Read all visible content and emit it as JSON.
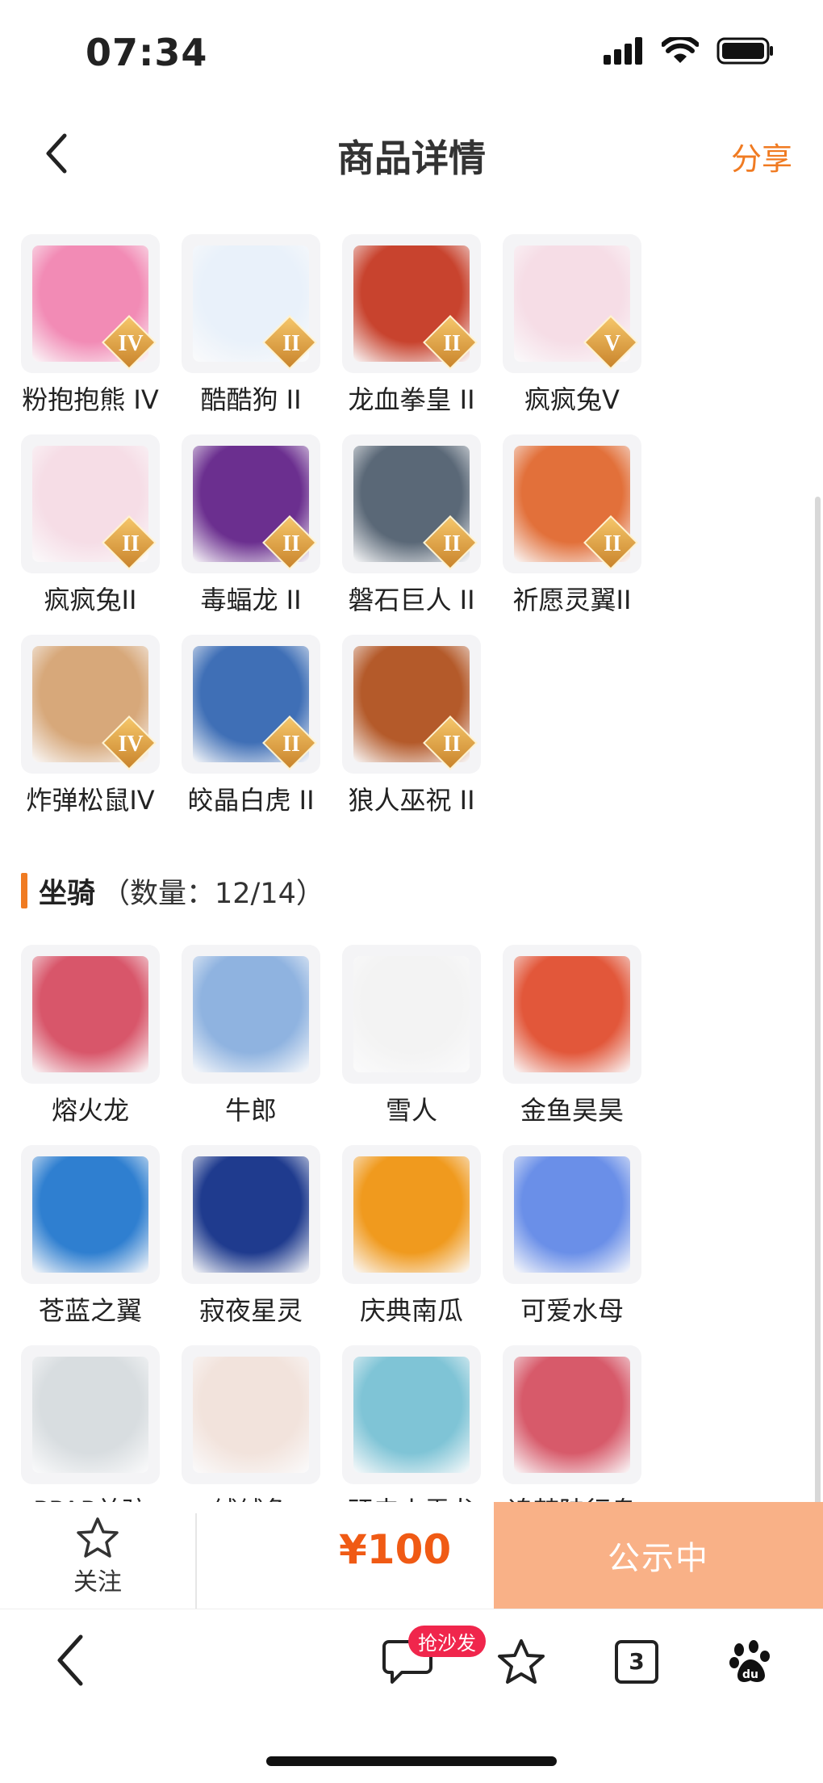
{
  "status_bar": {
    "time": "07:34"
  },
  "nav": {
    "title": "商品详情",
    "share_label": "分享"
  },
  "pets": [
    {
      "label": "粉抱抱熊 IV",
      "badge": "IV",
      "color": "#f28bb5"
    },
    {
      "label": "酷酷狗 II",
      "badge": "II",
      "color": "#e9f1fa"
    },
    {
      "label": "龙血拳皇 II",
      "badge": "II",
      "color": "#c8432e"
    },
    {
      "label": "疯疯兔V",
      "badge": "V",
      "color": "#f6dde6"
    },
    {
      "label": "疯疯兔II",
      "badge": "II",
      "color": "#f6dde6"
    },
    {
      "label": "毒蝠龙 II",
      "badge": "II",
      "color": "#6b2f8f"
    },
    {
      "label": "磐石巨人 II",
      "badge": "II",
      "color": "#5a6877"
    },
    {
      "label": "祈愿灵翼II",
      "badge": "II",
      "color": "#e2703a"
    },
    {
      "label": "炸弹松鼠IV",
      "badge": "IV",
      "color": "#d7a87a"
    },
    {
      "label": "皎晶白虎 II",
      "badge": "II",
      "color": "#3f6fb6"
    },
    {
      "label": "狼人巫祝 II",
      "badge": "II",
      "color": "#b45a2a"
    }
  ],
  "mounts_section": {
    "title": "坐骑",
    "count": "（数量：12/14）"
  },
  "mounts": [
    {
      "label": "熔火龙",
      "color": "#d8566a"
    },
    {
      "label": "牛郎",
      "color": "#8fb3e0"
    },
    {
      "label": "雪人",
      "color": "#f3f3f3"
    },
    {
      "label": "金鱼昊昊",
      "color": "#e2573a"
    },
    {
      "label": "苍蓝之翼",
      "color": "#2f7fd0"
    },
    {
      "label": "寂夜星灵",
      "color": "#1f3b8e"
    },
    {
      "label": "庆典南瓜",
      "color": "#f09a1e"
    },
    {
      "label": "可爱水母",
      "color": "#6a8fe8"
    },
    {
      "label": "PPAP羊驼",
      "color": "#d8dde0"
    },
    {
      "label": "绒绒兔",
      "color": "#f2e3dc"
    },
    {
      "label": "顽皮小雪龙",
      "color": "#7fc4d6"
    },
    {
      "label": "追梦陆行鸟",
      "color": "#d75a6a"
    }
  ],
  "action_bar": {
    "follow_label": "关注",
    "price": "¥100",
    "status_label": "公示中"
  },
  "browser_bar": {
    "tabs_count": "3",
    "hot_badge": "抢沙发"
  },
  "colors": {
    "accent": "#f07b22",
    "price": "#f05a14",
    "status_button": "#f9b187"
  }
}
